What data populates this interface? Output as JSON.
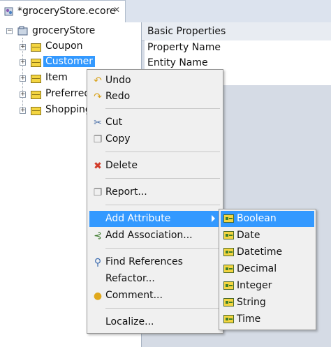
{
  "editor_tab": {
    "title": "*groceryStore.ecore",
    "close_glyph": "✕"
  },
  "tree": {
    "root": {
      "label": "groceryStore",
      "icon": "package-icon",
      "expanded": true
    },
    "items": [
      {
        "label": "Coupon",
        "icon": "class-icon",
        "selected": false
      },
      {
        "label": "Customer",
        "icon": "class-icon",
        "selected": true
      },
      {
        "label": "Item",
        "icon": "class-icon",
        "selected": false
      },
      {
        "label": "Preferred",
        "icon": "class-icon",
        "selected": false
      },
      {
        "label": "Shopping",
        "icon": "class-icon",
        "selected": false
      }
    ]
  },
  "properties": {
    "header": "Basic Properties",
    "rows": [
      "Property Name",
      "Entity Name"
    ]
  },
  "context_menu": {
    "items": [
      {
        "label": "Undo",
        "icon": "undo-icon"
      },
      {
        "label": "Redo",
        "icon": "redo-icon"
      },
      {
        "label": "Cut",
        "icon": "scissors-icon"
      },
      {
        "label": "Copy",
        "icon": "copy-icon"
      },
      {
        "label": "Delete",
        "icon": "delete-icon"
      },
      {
        "label": "Report...",
        "icon": "report-icon"
      },
      {
        "label": "Add Attribute",
        "icon": "",
        "has_submenu": true,
        "active": true
      },
      {
        "label": "Add Association...",
        "icon": "association-icon"
      },
      {
        "label": "Find References",
        "icon": "magnifier-icon"
      },
      {
        "label": "Refactor...",
        "icon": ""
      },
      {
        "label": "Comment...",
        "icon": "comment-icon"
      },
      {
        "label": "Localize...",
        "icon": ""
      }
    ]
  },
  "attribute_submenu": {
    "items": [
      {
        "label": "Boolean",
        "active": true
      },
      {
        "label": "Date"
      },
      {
        "label": "Datetime"
      },
      {
        "label": "Decimal"
      },
      {
        "label": "Integer"
      },
      {
        "label": "String"
      },
      {
        "label": "Time"
      }
    ]
  },
  "colors": {
    "selection": "#3399ff",
    "menu_bg": "#f0f0f0",
    "class_icon": "#f4d541"
  }
}
